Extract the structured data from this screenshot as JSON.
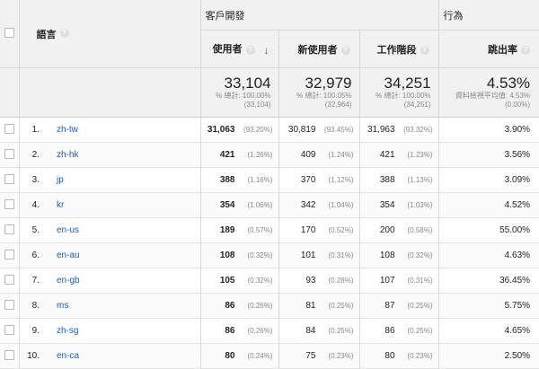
{
  "header": {
    "group_acquisition": "客戶開發",
    "group_behavior": "行為",
    "dimension_label": "語言",
    "help_glyph": "?",
    "sort_arrow": "↓",
    "metrics": [
      "使用者",
      "新使用者",
      "工作階段",
      "跳出率"
    ]
  },
  "totals": {
    "users": {
      "value": "33,104",
      "line1": "% 總計: 100.00%",
      "line2": "(33,104)"
    },
    "new_users": {
      "value": "32,979",
      "line1": "% 總計: 100.05%",
      "line2": "(32,964)"
    },
    "sessions": {
      "value": "34,251",
      "line1": "% 總計: 100.00%",
      "line2": "(34,251)"
    },
    "bounce": {
      "value": "4.53%",
      "line1": "資料檢視平均值: 4.53%",
      "line2": "(0.00%)"
    }
  },
  "rows": [
    {
      "idx": "1.",
      "lang": "zh-tw",
      "users": "31,063",
      "users_pct": "(93.20%)",
      "new": "30,819",
      "new_pct": "(93.45%)",
      "sess": "31,963",
      "sess_pct": "(93.32%)",
      "bounce": "3.90%"
    },
    {
      "idx": "2.",
      "lang": "zh-hk",
      "users": "421",
      "users_pct": "(1.26%)",
      "new": "409",
      "new_pct": "(1.24%)",
      "sess": "421",
      "sess_pct": "(1.23%)",
      "bounce": "3.56%"
    },
    {
      "idx": "3.",
      "lang": "jp",
      "users": "388",
      "users_pct": "(1.16%)",
      "new": "370",
      "new_pct": "(1.12%)",
      "sess": "388",
      "sess_pct": "(1.13%)",
      "bounce": "3.09%"
    },
    {
      "idx": "4.",
      "lang": "kr",
      "users": "354",
      "users_pct": "(1.06%)",
      "new": "342",
      "new_pct": "(1.04%)",
      "sess": "354",
      "sess_pct": "(1.03%)",
      "bounce": "4.52%"
    },
    {
      "idx": "5.",
      "lang": "en-us",
      "users": "189",
      "users_pct": "(0.57%)",
      "new": "170",
      "new_pct": "(0.52%)",
      "sess": "200",
      "sess_pct": "(0.58%)",
      "bounce": "55.00%"
    },
    {
      "idx": "6.",
      "lang": "en-au",
      "users": "108",
      "users_pct": "(0.32%)",
      "new": "101",
      "new_pct": "(0.31%)",
      "sess": "108",
      "sess_pct": "(0.32%)",
      "bounce": "4.63%"
    },
    {
      "idx": "7.",
      "lang": "en-gb",
      "users": "105",
      "users_pct": "(0.32%)",
      "new": "93",
      "new_pct": "(0.28%)",
      "sess": "107",
      "sess_pct": "(0.31%)",
      "bounce": "36.45%"
    },
    {
      "idx": "8.",
      "lang": "ms",
      "users": "86",
      "users_pct": "(0.26%)",
      "new": "81",
      "new_pct": "(0.25%)",
      "sess": "87",
      "sess_pct": "(0.25%)",
      "bounce": "5.75%"
    },
    {
      "idx": "9.",
      "lang": "zh-sg",
      "users": "86",
      "users_pct": "(0.26%)",
      "new": "84",
      "new_pct": "(0.25%)",
      "sess": "86",
      "sess_pct": "(0.25%)",
      "bounce": "4.65%"
    },
    {
      "idx": "10.",
      "lang": "en-ca",
      "users": "80",
      "users_pct": "(0.24%)",
      "new": "75",
      "new_pct": "(0.23%)",
      "sess": "80",
      "sess_pct": "(0.23%)",
      "bounce": "2.50%"
    }
  ],
  "colors": {
    "link": "#1a5fb4",
    "header_bg": "#f1f1f1",
    "muted": "#888888"
  }
}
